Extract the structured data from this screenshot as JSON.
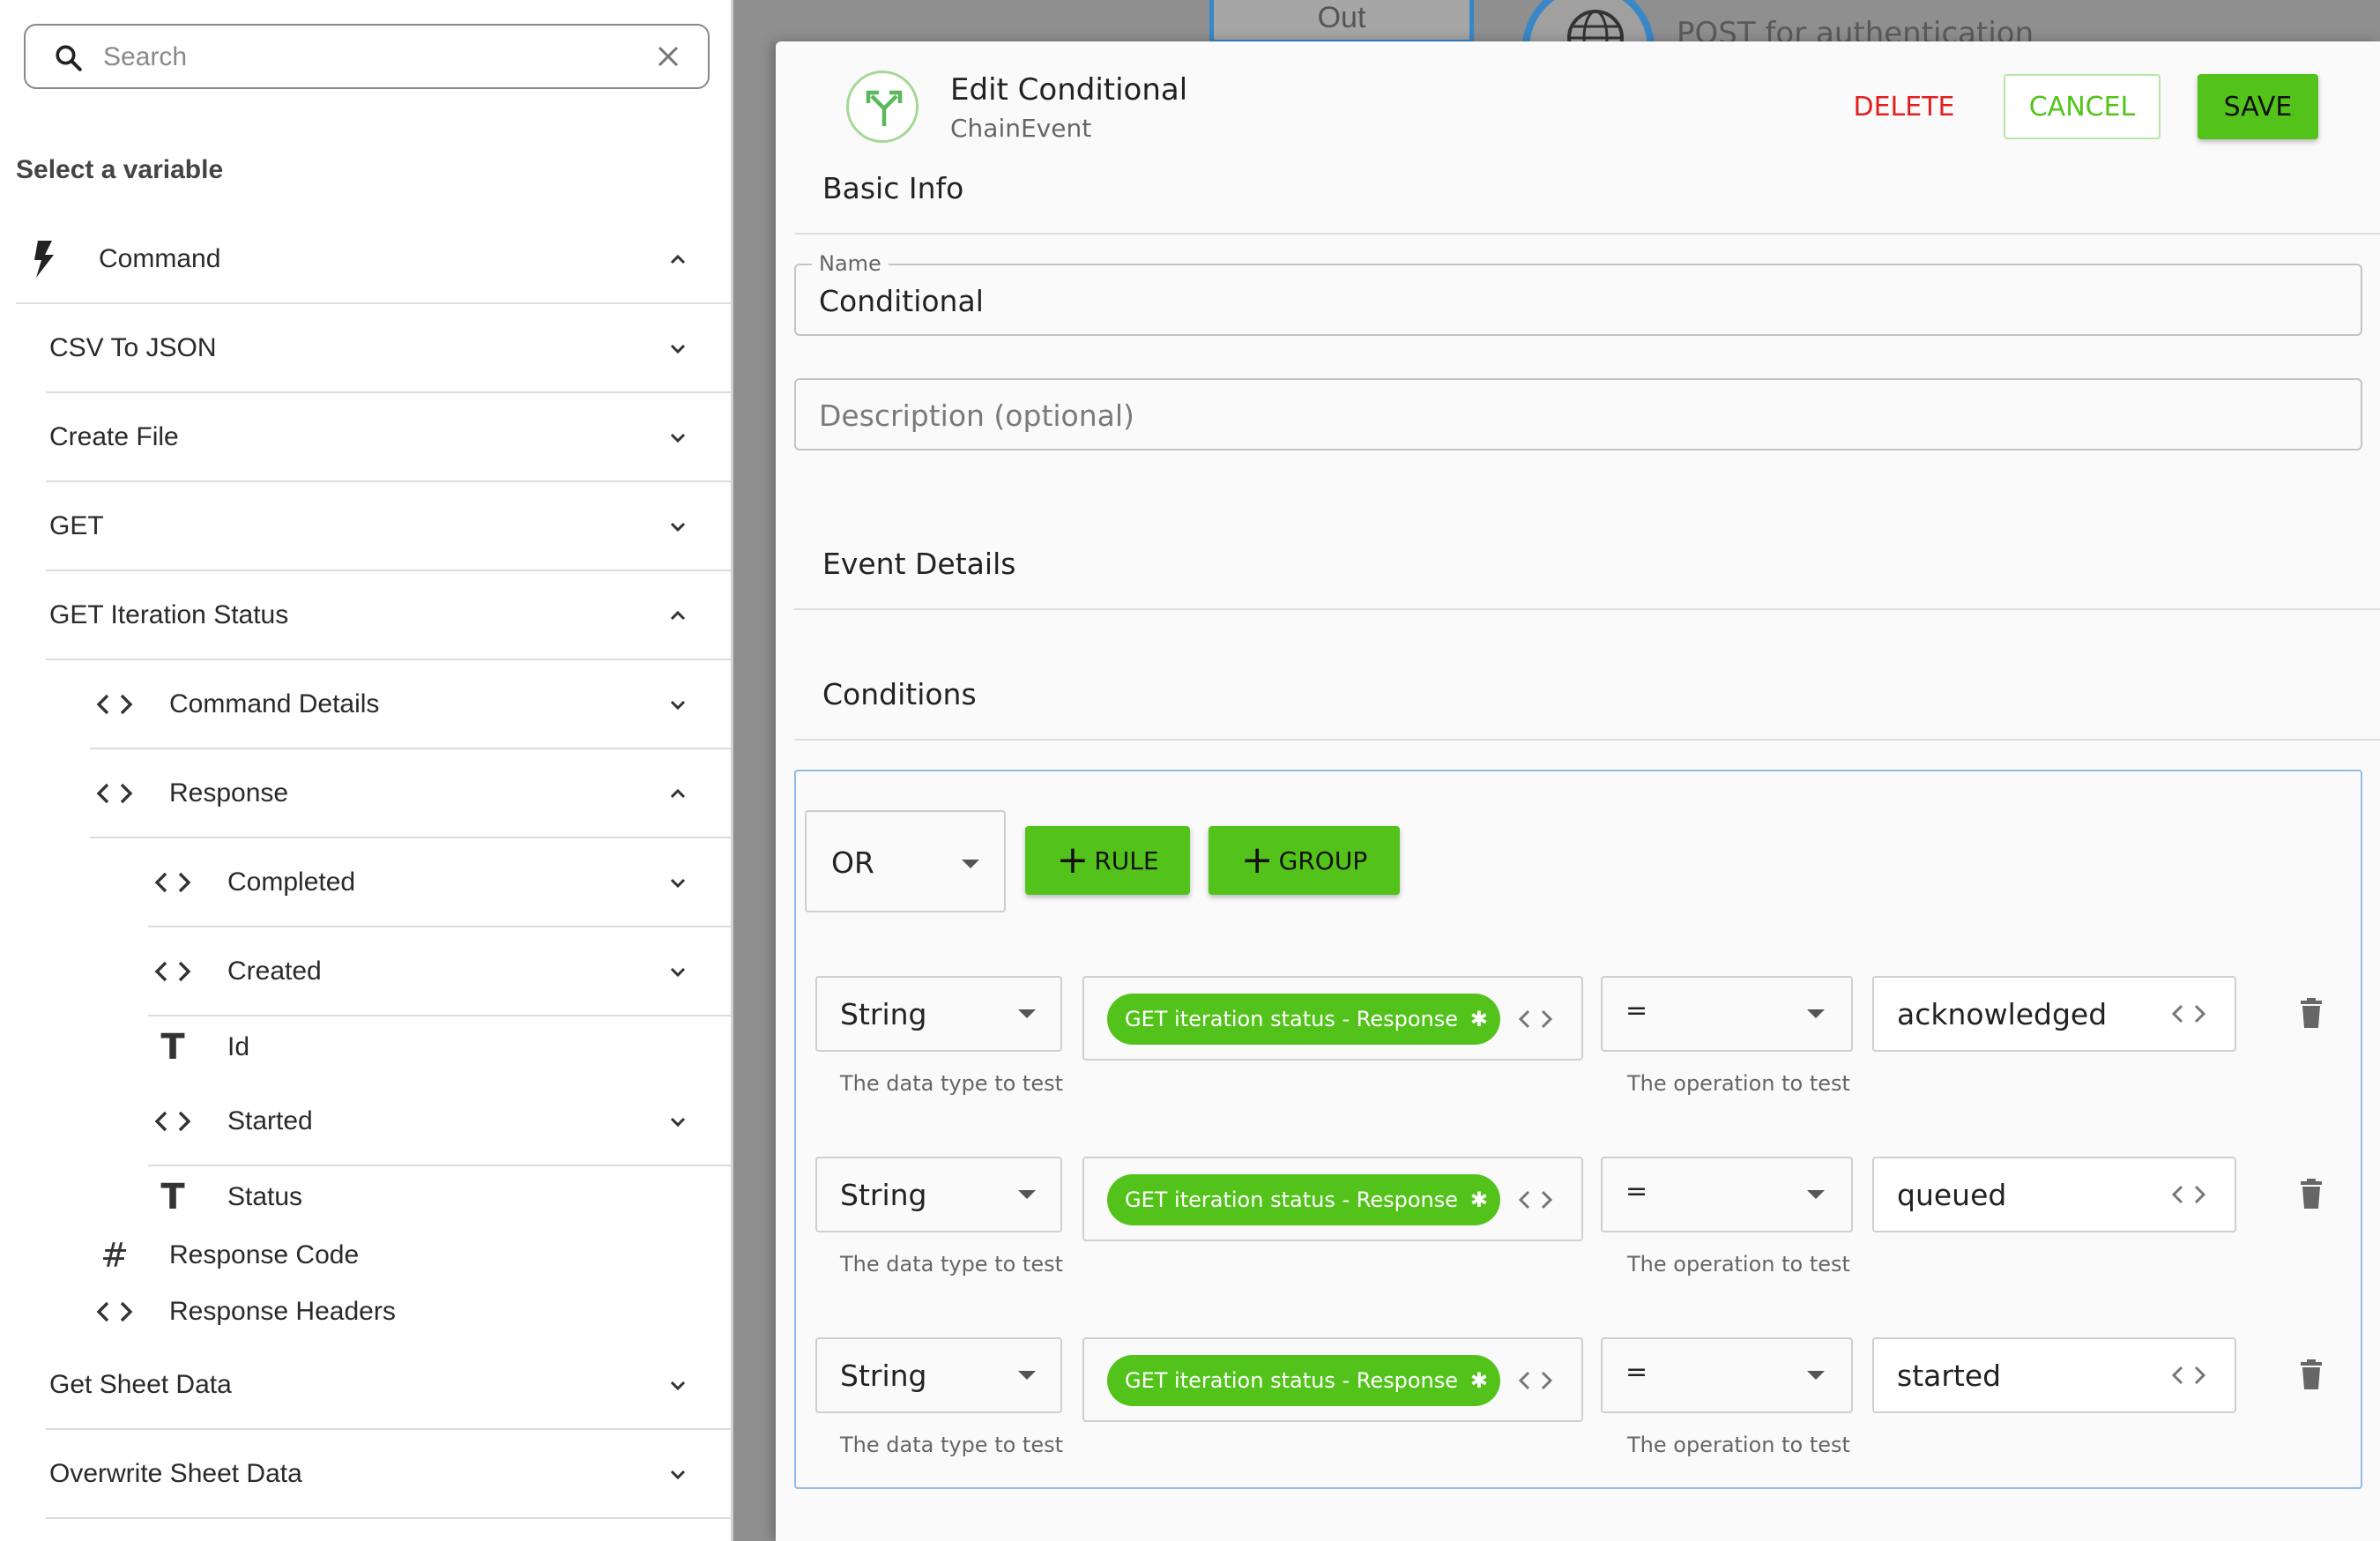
{
  "background": {
    "node_label": "Out",
    "node_title": "POST for authentication"
  },
  "sidebar": {
    "search_placeholder": "Search",
    "section_label": "Select a variable",
    "items": [
      {
        "label": "Command",
        "icon": "bolt-icon",
        "state": "expanded"
      },
      {
        "label": "CSV To JSON",
        "state": "collapsed"
      },
      {
        "label": "Create File",
        "state": "collapsed"
      },
      {
        "label": "GET",
        "state": "collapsed"
      },
      {
        "label": "GET Iteration Status",
        "state": "expanded"
      },
      {
        "label": "Command Details",
        "icon": "code-icon",
        "state": "collapsed"
      },
      {
        "label": "Response",
        "icon": "code-icon",
        "state": "expanded"
      },
      {
        "label": "Completed",
        "icon": "code-icon",
        "state": "collapsed"
      },
      {
        "label": "Created",
        "icon": "code-icon",
        "state": "collapsed"
      },
      {
        "label": "Id",
        "icon": "text-type-icon"
      },
      {
        "label": "Started",
        "icon": "code-icon",
        "state": "collapsed"
      },
      {
        "label": "Status",
        "icon": "text-type-icon"
      },
      {
        "label": "Response Code",
        "icon": "hash-icon"
      },
      {
        "label": "Response Headers",
        "icon": "code-icon"
      },
      {
        "label": "Get Sheet Data",
        "state": "collapsed"
      },
      {
        "label": "Overwrite Sheet Data",
        "state": "collapsed"
      }
    ]
  },
  "modal": {
    "title": "Edit Conditional",
    "subtitle": "ChainEvent",
    "delete_label": "DELETE",
    "cancel_label": "CANCEL",
    "save_label": "SAVE",
    "basic_info_title": "Basic Info",
    "name_label": "Name",
    "name_value": "Conditional",
    "description_placeholder": "Description (optional)",
    "event_details_title": "Event Details",
    "conditions_title": "Conditions",
    "combinator": "OR",
    "add_rule_label": "RULE",
    "add_group_label": "GROUP",
    "rules": [
      {
        "type": "String",
        "type_help": "The data type to test",
        "variable": "GET iteration status - Response",
        "operator": "=",
        "operator_help": "The operation to test",
        "value": "acknowledged"
      },
      {
        "type": "String",
        "type_help": "The data type to test",
        "variable": "GET iteration status - Response",
        "operator": "=",
        "operator_help": "The operation to test",
        "value": "queued"
      },
      {
        "type": "String",
        "type_help": "The data type to test",
        "variable": "GET iteration status - Response",
        "operator": "=",
        "operator_help": "The operation to test",
        "value": "started"
      }
    ]
  },
  "colors": {
    "accent_green": "#53c31b",
    "delete_red": "#e02020",
    "condition_border": "#8fbce8"
  }
}
